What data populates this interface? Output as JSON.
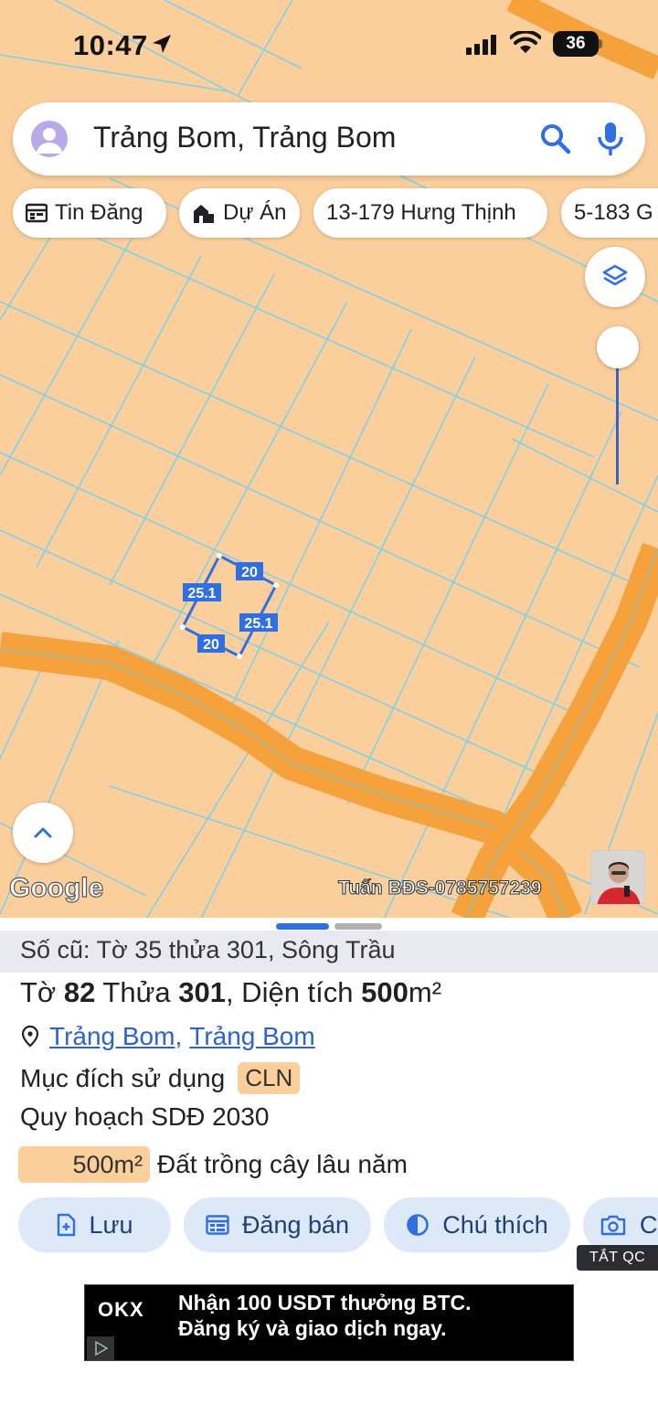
{
  "status_bar": {
    "time": "10:47",
    "battery": "36"
  },
  "search": {
    "query": "Trảng Bom, Trảng Bom"
  },
  "chips": [
    {
      "label": "Tin Đăng",
      "icon": "calendar-icon"
    },
    {
      "label": "Dự Án",
      "icon": "building-icon"
    },
    {
      "label": "13-179 Hưng Thịnh",
      "icon": ""
    },
    {
      "label": "5-183 G",
      "icon": ""
    }
  ],
  "map": {
    "parcel_edges": [
      "20",
      "25.1",
      "25.1",
      "20"
    ],
    "google_logo": "Google",
    "watermark": "Tuấn BĐS-0785757239",
    "colors": {
      "land": "#fbcf9c",
      "grid": "#7fd0e8",
      "road": "#f6a23c",
      "parcel": "#2f6fe2"
    }
  },
  "sheet": {
    "old_info": "Số cũ: Tờ 35 thửa 301, Sông Trầu",
    "title": {
      "p1": "Tờ ",
      "sheet_no": "82",
      "p2": " Thửa ",
      "parcel_no": "301",
      "p3": ", Diện tích ",
      "area": "500",
      "unit": "m²"
    },
    "address": {
      "part1": "Trảng Bom",
      "sep": ",",
      "part2": "Trảng Bom"
    },
    "purpose_label": "Mục đích sử dụng",
    "purpose_code": "CLN",
    "plan_label": "Quy hoạch SDĐ 2030",
    "plan_area": "500m²",
    "plan_desc": "Đất trồng cây lâu năm"
  },
  "actions": [
    {
      "label": "Lưu",
      "icon": "add-file-icon"
    },
    {
      "label": "Đăng bán",
      "icon": "listing-icon"
    },
    {
      "label": "Chú thích",
      "icon": "contrast-icon"
    },
    {
      "label": "C",
      "icon": "camera-icon"
    }
  ],
  "ad": {
    "close_label": "TẮT QC",
    "logo": "OKX",
    "line1": "Nhận 100 USDT thưởng BTC.",
    "line2": "Đăng ký và giao dịch ngay."
  }
}
